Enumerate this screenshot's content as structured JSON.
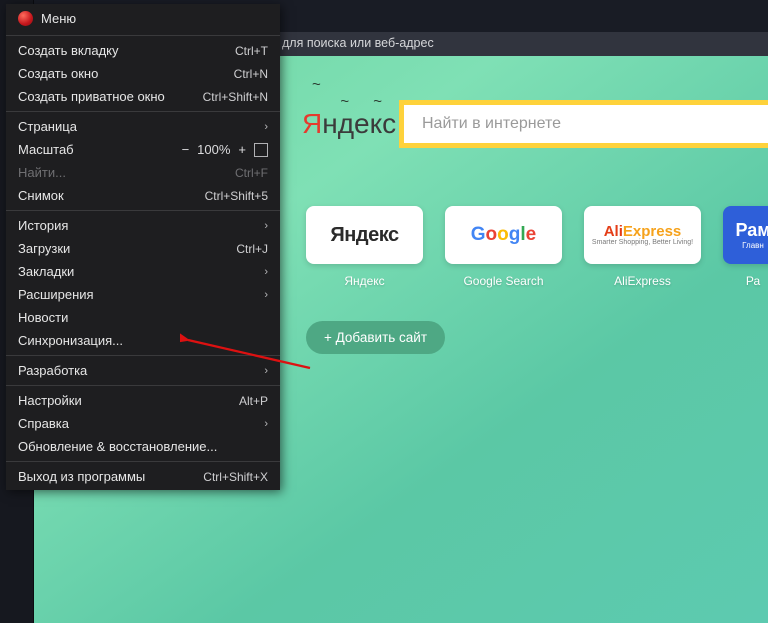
{
  "menu": {
    "title": "Меню",
    "items": {
      "new_tab": {
        "label": "Создать вкладку",
        "shortcut": "Ctrl+T"
      },
      "new_window": {
        "label": "Создать окно",
        "shortcut": "Ctrl+N"
      },
      "new_private": {
        "label": "Создать приватное окно",
        "shortcut": "Ctrl+Shift+N"
      },
      "page": {
        "label": "Страница"
      },
      "zoom": {
        "label": "Масштаб",
        "value": "100%"
      },
      "find": {
        "label": "Найти...",
        "shortcut": "Ctrl+F"
      },
      "snapshot": {
        "label": "Снимок",
        "shortcut": "Ctrl+Shift+5"
      },
      "history": {
        "label": "История"
      },
      "downloads": {
        "label": "Загрузки",
        "shortcut": "Ctrl+J"
      },
      "bookmarks": {
        "label": "Закладки"
      },
      "extensions": {
        "label": "Расширения"
      },
      "news": {
        "label": "Новости"
      },
      "sync": {
        "label": "Синхронизация..."
      },
      "developer": {
        "label": "Разработка"
      },
      "settings": {
        "label": "Настройки",
        "shortcut": "Alt+P"
      },
      "help": {
        "label": "Справка"
      },
      "update": {
        "label": "Обновление & восстановление..."
      },
      "exit": {
        "label": "Выход из программы",
        "shortcut": "Ctrl+Shift+X"
      }
    }
  },
  "address_hint": "для поиска или веб-адрес",
  "yandex_logo": {
    "first": "Я",
    "rest": "ндекс"
  },
  "search_placeholder": "Найти в интернете",
  "tiles": {
    "yandex": {
      "card": "Яндекс",
      "label": "Яндекс"
    },
    "google": {
      "label": "Google Search"
    },
    "ali": {
      "brand1": "Ali",
      "brand2": "Express",
      "tag": "Smarter Shopping, Better Living!",
      "label": "AliExpress"
    },
    "rambler": {
      "brand": "Рам",
      "tag": "Главн",
      "label": "Ра"
    }
  },
  "add_site": "+  Добавить сайт"
}
